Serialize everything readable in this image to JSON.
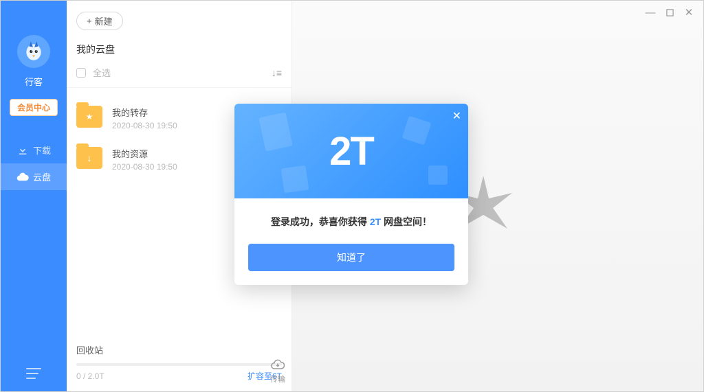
{
  "sidebar": {
    "username": "行客",
    "vip_label": "会员中心",
    "nav": {
      "download": "下载",
      "cloud": "云盘"
    }
  },
  "toolbar": {
    "new_label": "新建"
  },
  "panel": {
    "title": "我的云盘",
    "select_all": "全选"
  },
  "files": [
    {
      "name": "我的转存",
      "time": "2020-08-30 19:50",
      "icon": "save"
    },
    {
      "name": "我的资源",
      "time": "2020-08-30 19:50",
      "icon": "download"
    }
  ],
  "footer": {
    "recycle": "回收站",
    "storage_text": "0 / 2.0T",
    "expand_label": "扩容至6T",
    "transfer_label": "传输"
  },
  "modal": {
    "banner_text": "2T",
    "msg_prefix": "登录成功，恭喜你获得 ",
    "msg_highlight": "2T",
    "msg_suffix": " 网盘空间！",
    "ok_label": "知道了"
  }
}
